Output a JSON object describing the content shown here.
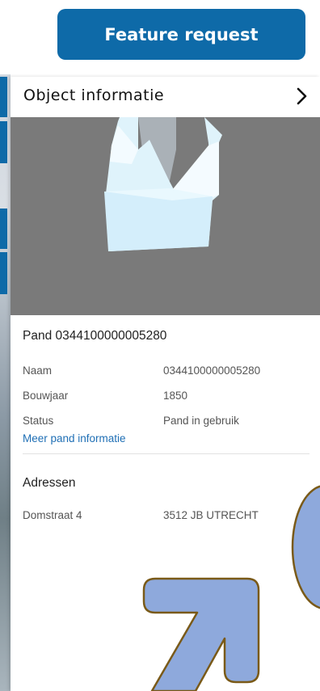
{
  "toolbar": {
    "feature_request_label": "Feature request"
  },
  "panel": {
    "title": "Object informatie",
    "building": {
      "name": "Pand 0344100000005280",
      "properties": [
        {
          "key": "Naam",
          "value": "0344100000005280"
        },
        {
          "key": "Bouwjaar",
          "value": "1850"
        },
        {
          "key": "Status",
          "value": "Pand in gebruik"
        }
      ],
      "more_link": "Meer pand informatie"
    },
    "addresses": {
      "title": "Adressen",
      "items": [
        {
          "street": "Domstraat 4",
          "postal_city": "3512 JB  UTRECHT"
        }
      ]
    }
  },
  "colors": {
    "accent": "#0e6aa8",
    "link": "#1f6fb5",
    "preview_bg": "#7a7a7a",
    "building": "#dff3fb",
    "overlay_fill": "#8ea9dc",
    "overlay_stroke": "#7a5a18"
  },
  "icons": {
    "close_panel": "chevron-right-icon",
    "overlay_arrow": "arrow-up-right-icon"
  }
}
